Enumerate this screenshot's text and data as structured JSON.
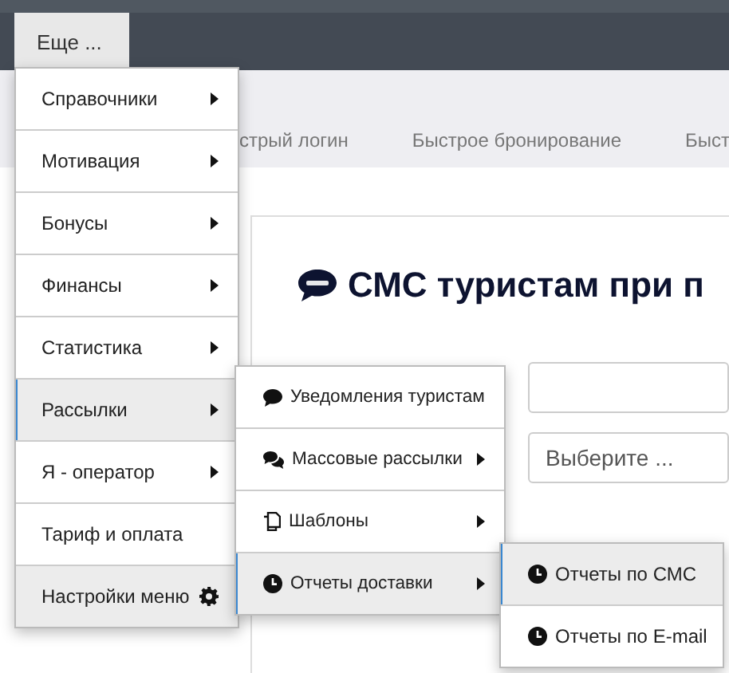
{
  "nav": {
    "more_button": "Еще ..."
  },
  "subnav": [
    {
      "label": "стрый логин"
    },
    {
      "label": "Быстрое бронирование"
    },
    {
      "label": "Быст"
    }
  ],
  "page_title": "СМС туристам при п",
  "form": {
    "select_placeholder": "Выберите ..."
  },
  "menu": [
    {
      "label": "Справочники",
      "kind": "submenu",
      "selected": false
    },
    {
      "label": "Мотивация",
      "kind": "submenu",
      "selected": false
    },
    {
      "label": "Бонусы",
      "kind": "submenu",
      "selected": false
    },
    {
      "label": "Финансы",
      "kind": "submenu",
      "selected": false
    },
    {
      "label": "Статистика",
      "kind": "submenu",
      "selected": false
    },
    {
      "label": "Рассылки",
      "kind": "submenu",
      "selected": true
    },
    {
      "label": "Я - оператор",
      "kind": "submenu",
      "selected": false
    },
    {
      "label": "Тариф и оплата",
      "kind": "link",
      "selected": false
    },
    {
      "label": "Настройки меню",
      "kind": "settings",
      "selected": false
    }
  ],
  "submenu": [
    {
      "label": "Уведомления туристам",
      "kind": "link",
      "selected": false
    },
    {
      "label": "Массовые рассылки",
      "kind": "submenu",
      "selected": false
    },
    {
      "label": "Шаблоны",
      "kind": "submenu",
      "selected": false
    },
    {
      "label": "Отчеты доставки",
      "kind": "submenu",
      "selected": true
    }
  ],
  "submenu_2": [
    {
      "label": "Отчеты по СМС",
      "selected": true
    },
    {
      "label": "Отчеты по E-mail",
      "selected": false
    }
  ]
}
